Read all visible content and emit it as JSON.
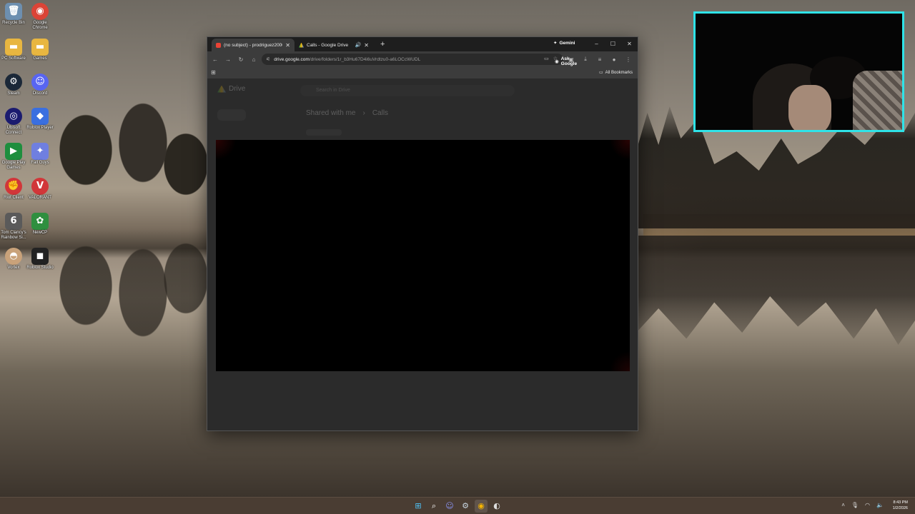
{
  "desktop": {
    "icons": [
      {
        "label": "Recycle Bin",
        "icon": "recycle-bin-icon",
        "color": "#6d8fb0",
        "glyph": "🗑"
      },
      {
        "label": "Google Chrome",
        "icon": "chrome-icon",
        "color": "#db4437",
        "glyph": "◉"
      },
      {
        "label": "PC Software",
        "icon": "folder-icon",
        "color": "#e8b640",
        "glyph": "▬"
      },
      {
        "label": "Games",
        "icon": "folder-icon",
        "color": "#e8b640",
        "glyph": "▬"
      },
      {
        "label": "Steam",
        "icon": "steam-icon",
        "color": "#1b2838",
        "glyph": "⚙"
      },
      {
        "label": "Discord",
        "icon": "discord-icon",
        "color": "#5865f2",
        "glyph": "☺"
      },
      {
        "label": "Ubisoft Connect",
        "icon": "ubisoft-icon",
        "color": "#1b1b6f",
        "glyph": "◎"
      },
      {
        "label": "Roblox Player",
        "icon": "roblox-icon",
        "color": "#3a6fe0",
        "glyph": "◆"
      },
      {
        "label": "Google Play Games",
        "icon": "play-games-icon",
        "color": "#1e8e3e",
        "glyph": "▶"
      },
      {
        "label": "Fall Guys",
        "icon": "fall-guys-icon",
        "color": "#6f7fe0",
        "glyph": "✦"
      },
      {
        "label": "Riot Client",
        "icon": "riot-icon",
        "color": "#d13639",
        "glyph": "✊"
      },
      {
        "label": "VALORANT",
        "icon": "valorant-icon",
        "color": "#d13639",
        "glyph": "V"
      },
      {
        "label": "Tom Clancy's Rainbow Si...",
        "icon": "rainbow-six-icon",
        "color": "#5a5a5a",
        "glyph": "6"
      },
      {
        "label": "NewCP",
        "icon": "newcp-icon",
        "color": "#2f8f3f",
        "glyph": "✿"
      },
      {
        "label": "Vortex",
        "icon": "vortex-icon",
        "color": "#c9a27a",
        "glyph": "◓"
      },
      {
        "label": "Roblox Studio",
        "icon": "roblox-studio-icon",
        "color": "#222222",
        "glyph": "◼"
      }
    ]
  },
  "browser": {
    "tabs": [
      {
        "title": "(no subject) - prodriguez2000!",
        "icon": "gmail-icon",
        "active": true
      },
      {
        "title": "Calls - Google Drive",
        "icon": "google-drive-icon",
        "active": false,
        "audio": true
      }
    ],
    "new_tab_symbol": "+",
    "gemini_label": "Gemini",
    "url_host": "drive.google.com",
    "url_path": "/drive/folders/1r_b3Hu67D4i6uVrdtzu0-a6LOCcWUDL",
    "ask_google_label": "Ask Google",
    "all_bookmarks_label": "All Bookmarks"
  },
  "drive_page": {
    "app_name": "Drive",
    "search_placeholder": "Search in Drive",
    "breadcrumb_root": "Shared with me",
    "breadcrumb_sep": "›",
    "breadcrumb_folder": "Calls"
  },
  "taskbar": {
    "apps": [
      {
        "icon": "windows-start-icon",
        "glyph": "⊞"
      },
      {
        "icon": "search-icon",
        "glyph": "⌕"
      },
      {
        "icon": "discord-icon",
        "glyph": "☺"
      },
      {
        "icon": "steam-icon",
        "glyph": "⚙"
      },
      {
        "icon": "chrome-icon",
        "glyph": "◉"
      },
      {
        "icon": "obs-icon",
        "glyph": "◐"
      }
    ],
    "time": "8:43 PM",
    "date": "1/2/2026"
  },
  "colors": {
    "webcam_border": "#2fe3e8",
    "taskbar": "#4a3d33",
    "browser_toolbar": "#3c3c3c"
  }
}
